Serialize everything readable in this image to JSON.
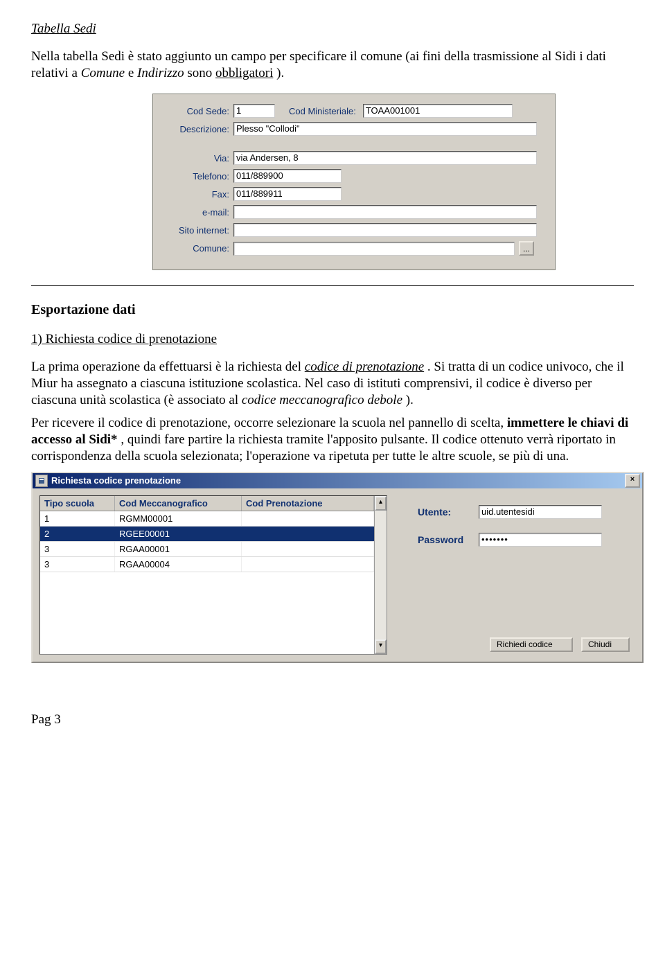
{
  "section_title": "Tabella Sedi",
  "intro_text_1": "Nella tabella Sedi è stato aggiunto un campo per specificare il comune (ai fini della trasmissione al Sidi i dati relativi a ",
  "intro_text_2": "Comune",
  "intro_text_3": " e ",
  "intro_text_4": "Indirizzo",
  "intro_text_5": " sono ",
  "intro_text_6": "obbligatori",
  "intro_text_7": ").",
  "form1": {
    "cod_sede_label": "Cod Sede:",
    "cod_sede_value": "1",
    "cod_min_label": "Cod Ministeriale:",
    "cod_min_value": "TOAA001001",
    "descrizione_label": "Descrizione:",
    "descrizione_value": "Plesso \"Collodi\"",
    "via_label": "Via:",
    "via_value": "via Andersen, 8",
    "telefono_label": "Telefono:",
    "telefono_value": "011/889900",
    "fax_label": "Fax:",
    "fax_value": "011/889911",
    "email_label": "e-mail:",
    "email_value": "",
    "sito_label": "Sito internet:",
    "sito_value": "",
    "comune_label": "Comune:",
    "comune_value": "",
    "browse_btn": "..."
  },
  "heading2": "Esportazione dati",
  "sub_heading": "1) Richiesta codice di prenotazione",
  "para1_a": "La prima operazione da effettuarsi è la richiesta del ",
  "para1_b": "codice di prenotazione",
  "para1_c": ". Si tratta di un codice univoco, che il  Miur ha assegnato a ciascuna istituzione scolastica. Nel caso di istituti comprensivi, il codice è diverso per ciascuna unità scolastica (è associato al ",
  "para1_d": "codice meccanografico debole",
  "para1_e": ").",
  "para2_a": "Per ricevere il codice di prenotazione, occorre selezionare la scuola nel pannello di scelta, ",
  "para2_b": "immettere le chiavi di accesso al Sidi*",
  "para2_c": " , quindi fare partire la richiesta tramite l'apposito pulsante. Il codice ottenuto verrà riportato in corrispondenza della scuola selezionata; l'operazione va ripetuta per tutte le altre scuole, se più di una.",
  "dialog": {
    "title": "Richiesta codice prenotazione",
    "col_tipo": "Tipo scuola",
    "col_mecc": "Cod Meccanografico",
    "col_pren": "Cod Prenotazione",
    "rows": [
      {
        "tipo": "1",
        "mecc": "RGMM00001",
        "pren": ""
      },
      {
        "tipo": "2",
        "mecc": "RGEE00001",
        "pren": ""
      },
      {
        "tipo": "3",
        "mecc": "RGAA00001",
        "pren": ""
      },
      {
        "tipo": "3",
        "mecc": "RGAA00004",
        "pren": ""
      }
    ],
    "utente_label": "Utente:",
    "utente_value": "uid.utentesidi",
    "password_label": "Password",
    "password_value": "•••••••",
    "richiedi_btn": "Richiedi codice",
    "chiudi_btn": "Chiudi"
  },
  "footer": "Pag 3"
}
